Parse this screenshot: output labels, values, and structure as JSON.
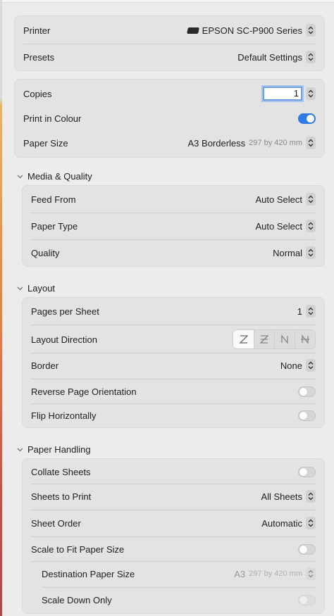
{
  "printer_group": {
    "printer_label": "Printer",
    "printer_value": "EPSON SC-P900 Series",
    "presets_label": "Presets",
    "presets_value": "Default Settings"
  },
  "basic_group": {
    "copies_label": "Copies",
    "copies_value": "1",
    "colour_label": "Print in Colour",
    "colour_on": true,
    "paper_size_label": "Paper Size",
    "paper_size_value": "A3 Borderless",
    "paper_size_dims": "297 by 420 mm"
  },
  "media_quality": {
    "heading": "Media & Quality",
    "feed_label": "Feed From",
    "feed_value": "Auto Select",
    "paper_type_label": "Paper Type",
    "paper_type_value": "Auto Select",
    "quality_label": "Quality",
    "quality_value": "Normal"
  },
  "layout": {
    "heading": "Layout",
    "pages_label": "Pages per Sheet",
    "pages_value": "1",
    "direction_label": "Layout Direction",
    "direction_options": [
      "z-order-icon",
      "reverse-z-order-icon",
      "n-order-icon",
      "reverse-n-order-icon"
    ],
    "border_label": "Border",
    "border_value": "None",
    "reverse_label": "Reverse Page Orientation",
    "reverse_on": false,
    "flip_label": "Flip Horizontally",
    "flip_on": false
  },
  "paper_handling": {
    "heading": "Paper Handling",
    "collate_label": "Collate Sheets",
    "collate_on": false,
    "sheets_label": "Sheets to Print",
    "sheets_value": "All Sheets",
    "order_label": "Sheet Order",
    "order_value": "Automatic",
    "scale_label": "Scale to Fit Paper Size",
    "scale_on": false,
    "dest_label": "Destination Paper Size",
    "dest_value": "A3",
    "dest_dims": "297 by 420 mm",
    "scale_down_label": "Scale Down Only",
    "scale_down_on": false
  },
  "colors": {
    "accent": "#2f7ae5",
    "group_bg": "#e3e3e3",
    "window_bg": "#ececec"
  }
}
